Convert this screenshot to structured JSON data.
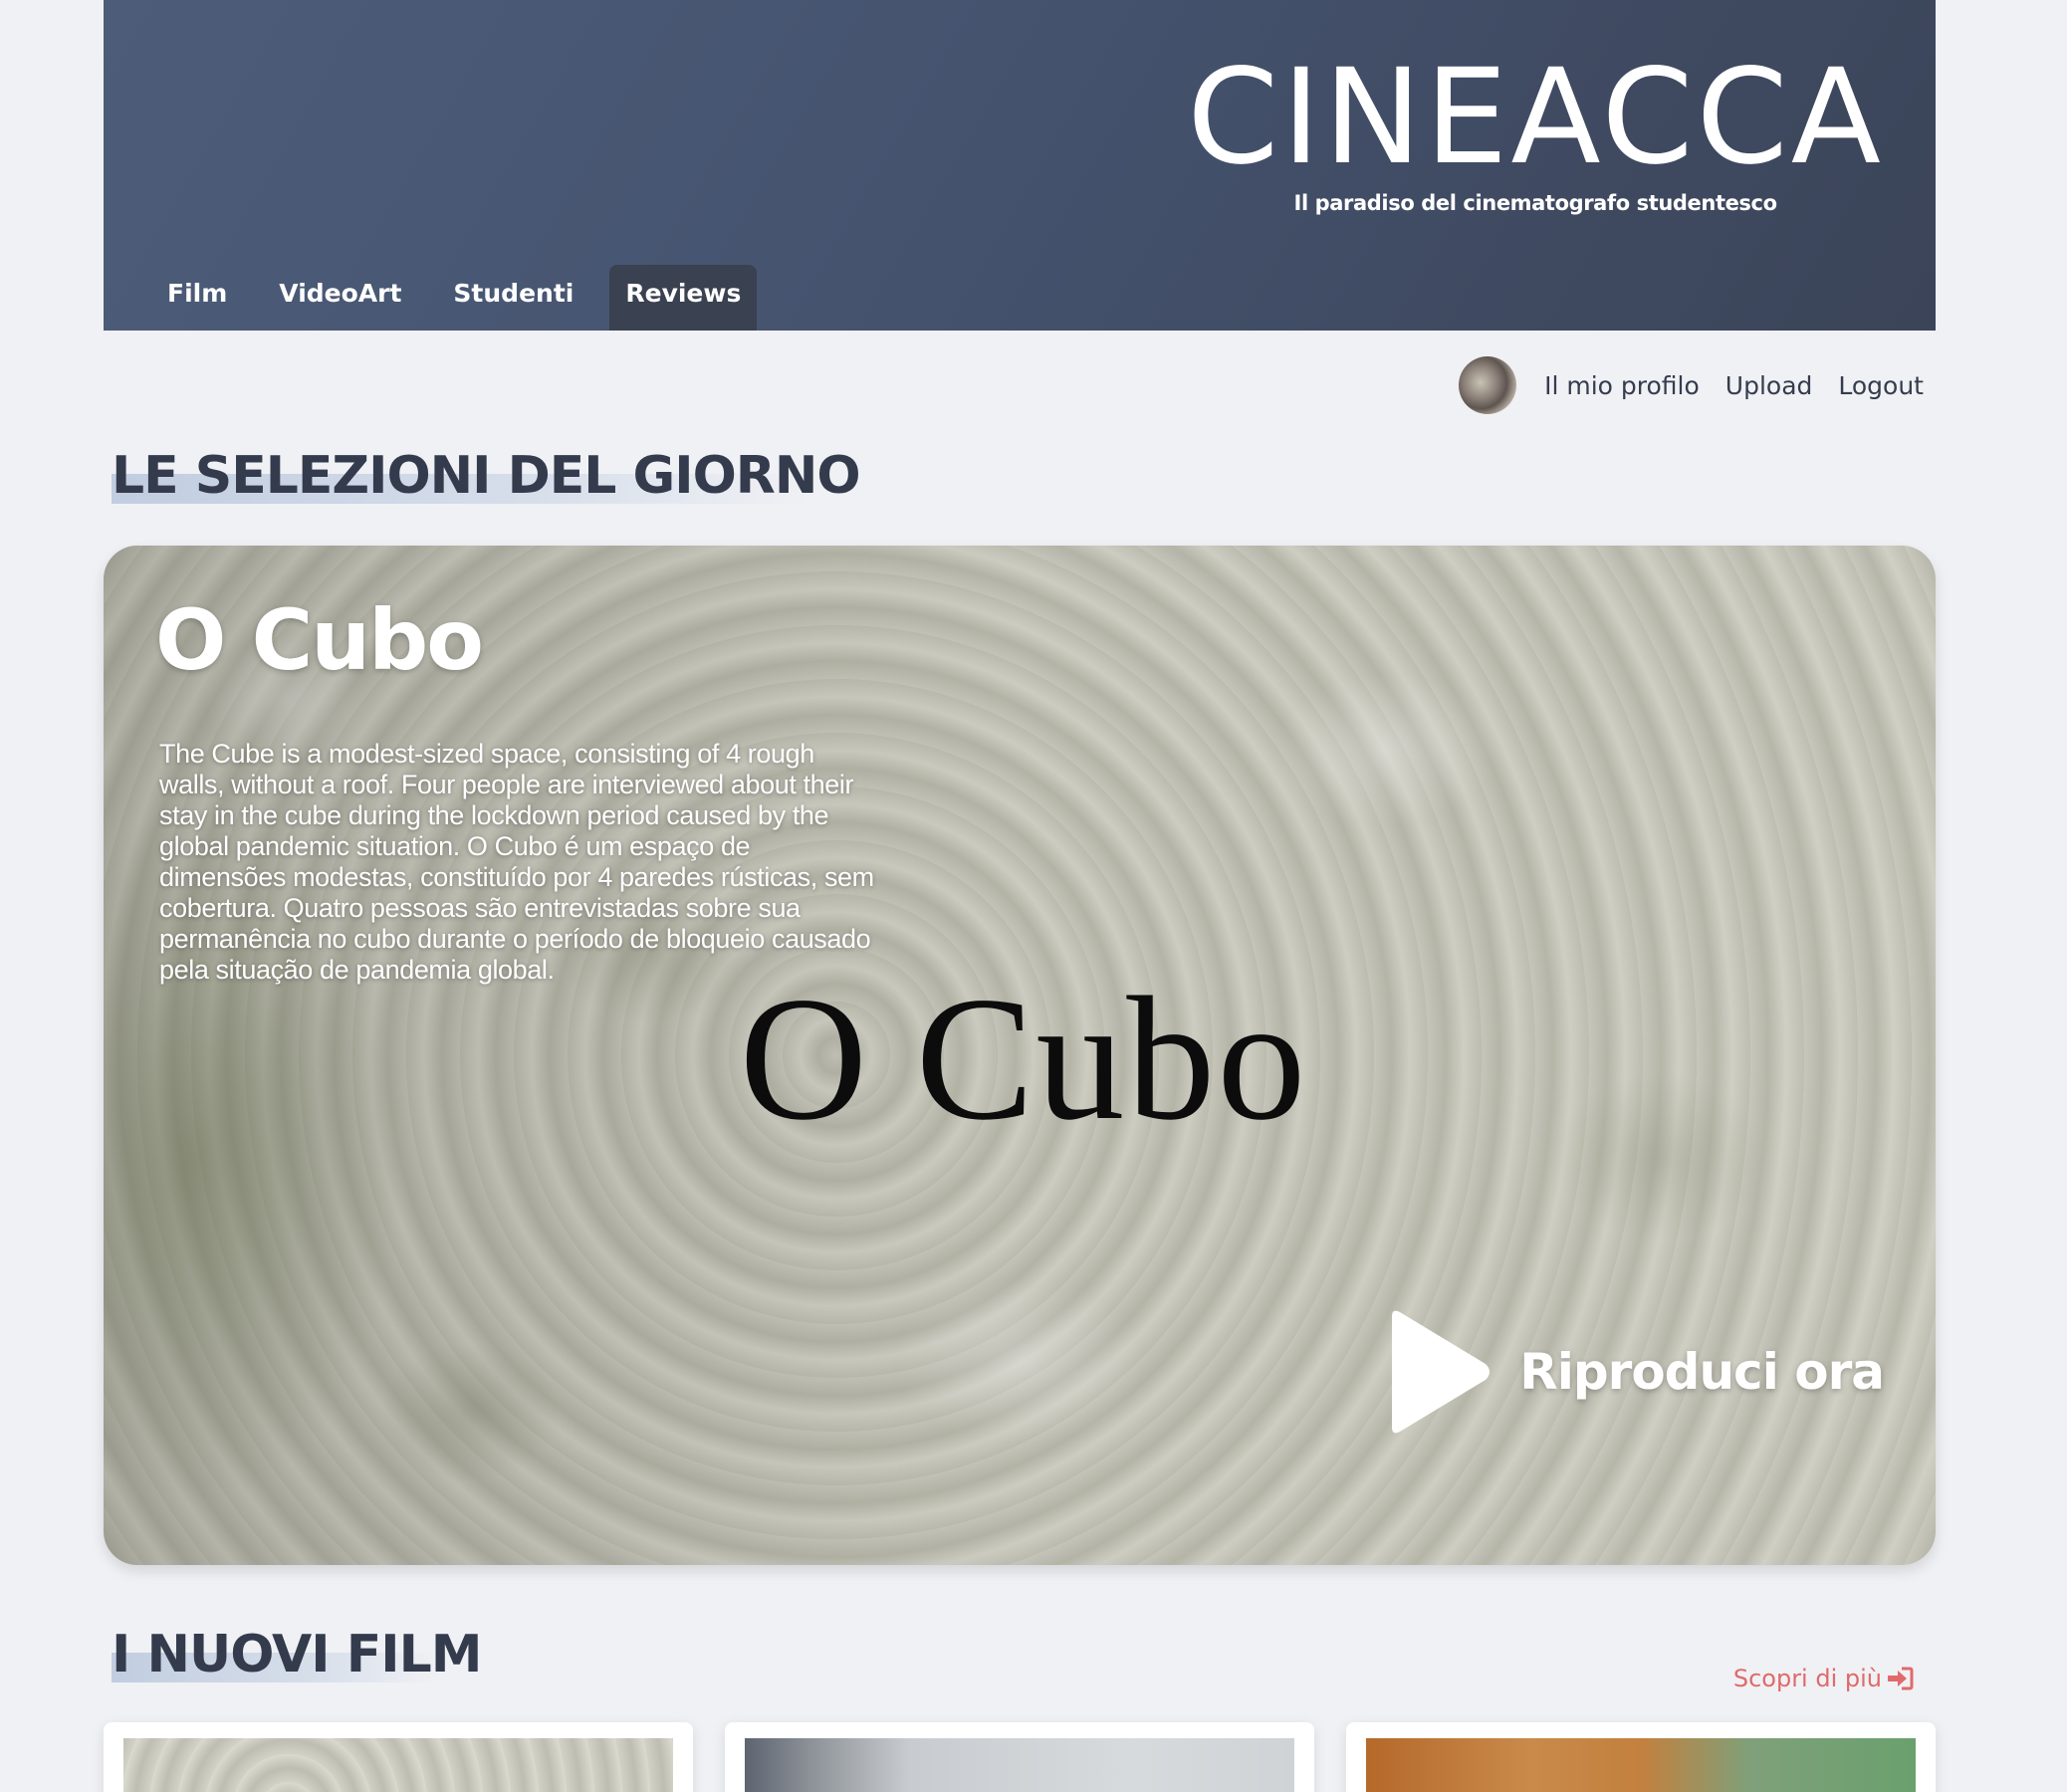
{
  "header": {
    "brand_title": "CINEACCA",
    "brand_subtitle": "Il paradiso del cinematografo studentesco",
    "nav": [
      {
        "label": "Film"
      },
      {
        "label": "VideoArt"
      },
      {
        "label": "Studenti"
      },
      {
        "label": "Reviews",
        "active": true
      }
    ]
  },
  "userbar": {
    "profile_label": "Il mio profilo",
    "upload_label": "Upload",
    "logout_label": "Logout"
  },
  "featured_section": {
    "title": "LE SELEZIONI DEL GIORNO",
    "film": {
      "title": "O Cubo",
      "description": "The Cube is a modest-sized space, consisting of 4 rough walls, without a roof. Four people are interviewed about their stay in the cube during the lockdown period caused by the global pandemic situation. O Cubo é um espaço de dimensões modestas, constituído por 4 paredes rústicas, sem cobertura. Quatro pessoas são entrevistadas sobre sua permanência no cubo durante o período de bloqueio causado pela situação de pandemia global.",
      "poster_text": "O Cubo",
      "play_label": "Riproduci ora"
    }
  },
  "new_films_section": {
    "title": "I NUOVI FILM",
    "more_label": "Scopri di più"
  },
  "colors": {
    "header_bg": "#475672",
    "page_bg": "#f0f1f5",
    "heading": "#343b4c",
    "accent_link": "#e06a6a",
    "nav_active_bg": "#3a4150"
  },
  "icons": {
    "play": "play-icon",
    "more": "sign-in-arrow-icon"
  }
}
